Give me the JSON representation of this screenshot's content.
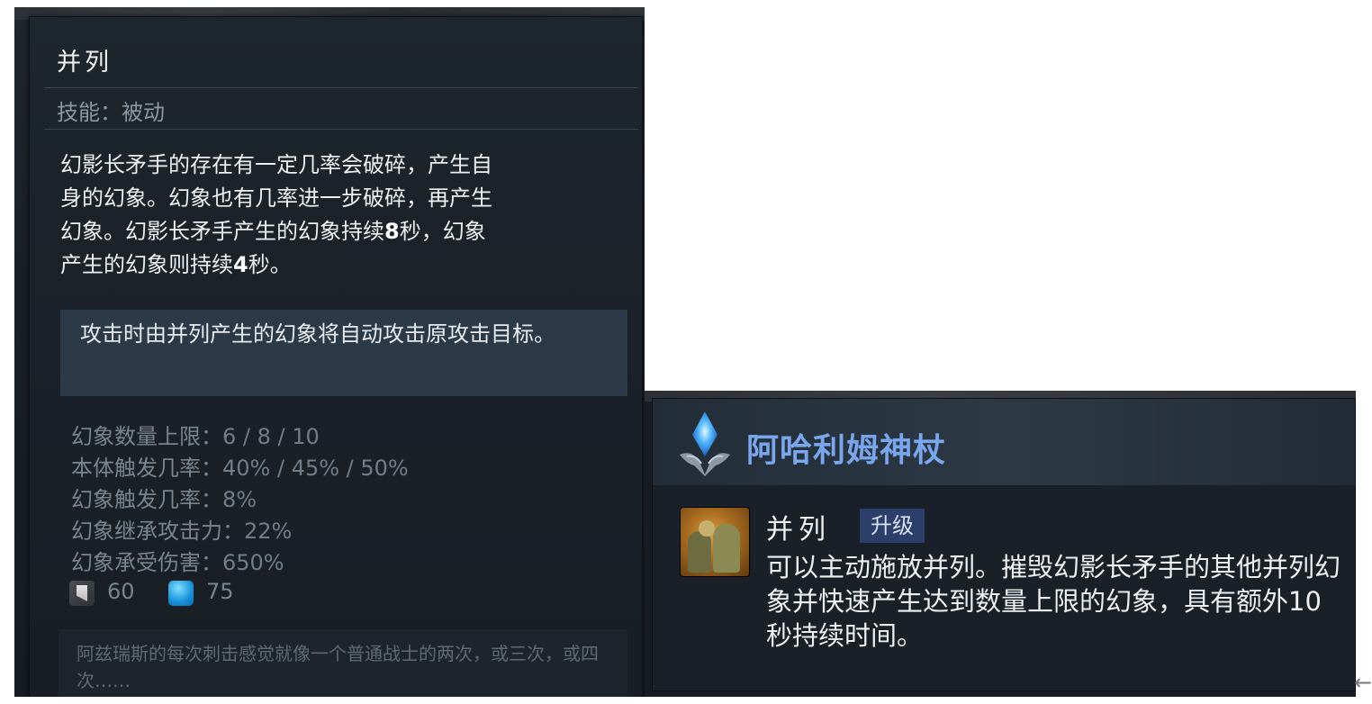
{
  "left_tooltip": {
    "ability_name": "并列",
    "skill_type": "技能：被动",
    "description": {
      "line1": "幻影长矛手的存在有一定几率会破碎，产生自",
      "line2": "身的幻象。幻象也有几率进一步破碎，再产生",
      "line3_a": "幻象。幻影长矛手产生的幻象持续",
      "line3_num": "8",
      "line3_b": "秒，幻象",
      "line4_a": "产生的幻象则持续",
      "line4_num": "4",
      "line4_b": "秒。"
    },
    "note": "攻击时由并列产生的幻象将自动攻击原攻击目标。",
    "stats": [
      {
        "label": "幻象数量上限：",
        "value": "6 / 8 / 10"
      },
      {
        "label": "本体触发几率：",
        "value": "40% / 45% / 50%"
      },
      {
        "label": "幻象触发几率：",
        "value": "8%"
      },
      {
        "label": "幻象继承攻击力：",
        "value": "22%"
      },
      {
        "label": "幻象承受伤害：",
        "value": "650%"
      }
    ],
    "cooldown": "60",
    "mana_cost": "75",
    "lore": "阿兹瑞斯的每次刺击感觉就像一个普通战士的两次，或三次，或四次……"
  },
  "right_tooltip": {
    "scepter_title": "阿哈利姆神杖",
    "ability_name": "并列",
    "badge": "升级",
    "description": "可以主动施放并列。摧毁幻影长矛手的其他并列幻象并快速产生达到数量上限的幻象，具有额外10秒持续时间。"
  },
  "nav": {
    "back_glyph": "←"
  },
  "colors": {
    "panel_bg": "#1b2229",
    "note_bg": "#2c3a47",
    "scepter_title": "#7aa6ee",
    "badge_bg": "#2c3f6b",
    "mana_blue": "#1591d8"
  },
  "icons": [
    "cooldown-icon",
    "mana-icon",
    "aghanims-scepter-icon",
    "juxtapose-ability-icon",
    "back-arrow-icon"
  ]
}
